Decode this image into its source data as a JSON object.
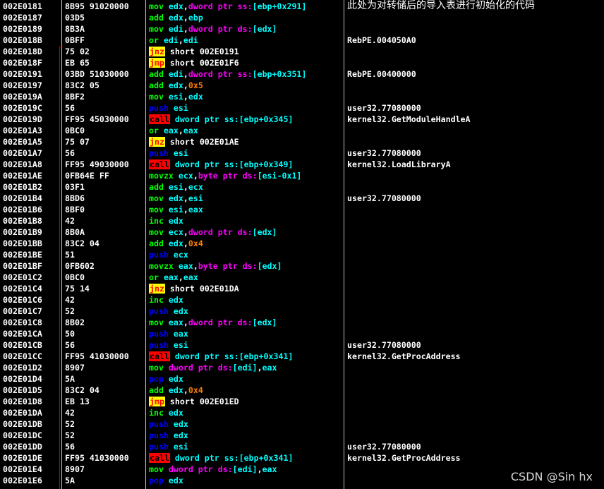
{
  "title": "此处为对转储后的导入表进行初始化的代码",
  "watermark": "CSDN @Sin hx",
  "rows": [
    {
      "addr": "002E0181",
      "hex": "8B95 91020000",
      "asm": [
        [
          "green",
          "mov "
        ],
        [
          "cyan",
          "edx"
        ],
        [
          "white",
          ","
        ],
        [
          "magenta",
          "dword ptr ss:"
        ],
        [
          "cyan",
          "[ebp+0x291]"
        ]
      ],
      "comment": ""
    },
    {
      "addr": "002E0187",
      "hex": "03D5",
      "asm": [
        [
          "green",
          "add "
        ],
        [
          "cyan",
          "edx"
        ],
        [
          "white",
          ","
        ],
        [
          "cyan",
          "ebp"
        ]
      ],
      "comment": ""
    },
    {
      "addr": "002E0189",
      "hex": "8B3A",
      "asm": [
        [
          "green",
          "mov "
        ],
        [
          "cyan",
          "edi"
        ],
        [
          "white",
          ","
        ],
        [
          "magenta",
          "dword ptr ds:"
        ],
        [
          "cyan",
          "[edx]"
        ]
      ],
      "comment": ""
    },
    {
      "addr": "002E018B",
      "hex": "0BFF",
      "asm": [
        [
          "green",
          "or "
        ],
        [
          "cyan",
          "edi"
        ],
        [
          "white",
          ","
        ],
        [
          "cyan",
          "edi"
        ]
      ],
      "comment": "RebPE.004050A0"
    },
    {
      "addr": "002E018D",
      "hex": "75 02",
      "asm": [
        [
          "jump",
          "jnz"
        ],
        [
          "white",
          " short 002E0191"
        ]
      ],
      "comment": ""
    },
    {
      "addr": "002E018F",
      "hex": "EB 65",
      "asm": [
        [
          "jump",
          "jmp"
        ],
        [
          "white",
          " short 002E01F6"
        ]
      ],
      "comment": ""
    },
    {
      "addr": "002E0191",
      "hex": "03BD 51030000",
      "asm": [
        [
          "green",
          "add "
        ],
        [
          "cyan",
          "edi"
        ],
        [
          "white",
          ","
        ],
        [
          "magenta",
          "dword ptr ss:"
        ],
        [
          "cyan",
          "[ebp+0x351]"
        ]
      ],
      "comment": "RebPE.00400000"
    },
    {
      "addr": "002E0197",
      "hex": "83C2 05",
      "asm": [
        [
          "green",
          "add "
        ],
        [
          "cyan",
          "edx"
        ],
        [
          "white",
          ","
        ],
        [
          "orange",
          "0x5"
        ]
      ],
      "comment": ""
    },
    {
      "addr": "002E019A",
      "hex": "8BF2",
      "asm": [
        [
          "green",
          "mov "
        ],
        [
          "cyan",
          "esi"
        ],
        [
          "white",
          ","
        ],
        [
          "cyan",
          "edx"
        ]
      ],
      "comment": ""
    },
    {
      "addr": "002E019C",
      "hex": "56",
      "asm": [
        [
          "blue",
          "push "
        ],
        [
          "cyan",
          "esi"
        ]
      ],
      "comment": "user32.77080000"
    },
    {
      "addr": "002E019D",
      "hex": "FF95 45030000",
      "asm": [
        [
          "call",
          "call"
        ],
        [
          "cyan",
          " dword ptr ss:"
        ],
        [
          "cyan",
          "[ebp+0x345]"
        ]
      ],
      "comment": "kernel32.GetModuleHandleA"
    },
    {
      "addr": "002E01A3",
      "hex": "0BC0",
      "asm": [
        [
          "green",
          "or "
        ],
        [
          "cyan",
          "eax"
        ],
        [
          "white",
          ","
        ],
        [
          "cyan",
          "eax"
        ]
      ],
      "comment": ""
    },
    {
      "addr": "002E01A5",
      "hex": "75 07",
      "asm": [
        [
          "jump",
          "jnz"
        ],
        [
          "white",
          " short 002E01AE"
        ]
      ],
      "comment": ""
    },
    {
      "addr": "002E01A7",
      "hex": "56",
      "asm": [
        [
          "blue",
          "push "
        ],
        [
          "cyan",
          "esi"
        ]
      ],
      "comment": "user32.77080000"
    },
    {
      "addr": "002E01A8",
      "hex": "FF95 49030000",
      "asm": [
        [
          "call",
          "call"
        ],
        [
          "cyan",
          " dword ptr ss:"
        ],
        [
          "cyan",
          "[ebp+0x349]"
        ]
      ],
      "comment": "kernel32.LoadLibraryA"
    },
    {
      "addr": "002E01AE",
      "hex": "0FB64E FF",
      "asm": [
        [
          "green",
          "movzx "
        ],
        [
          "cyan",
          "ecx"
        ],
        [
          "white",
          ","
        ],
        [
          "magenta",
          "byte ptr ds:"
        ],
        [
          "cyan",
          "[esi-0x1]"
        ]
      ],
      "comment": ""
    },
    {
      "addr": "002E01B2",
      "hex": "03F1",
      "asm": [
        [
          "green",
          "add "
        ],
        [
          "cyan",
          "esi"
        ],
        [
          "white",
          ","
        ],
        [
          "cyan",
          "ecx"
        ]
      ],
      "comment": ""
    },
    {
      "addr": "002E01B4",
      "hex": "8BD6",
      "asm": [
        [
          "green",
          "mov "
        ],
        [
          "cyan",
          "edx"
        ],
        [
          "white",
          ","
        ],
        [
          "cyan",
          "esi"
        ]
      ],
      "comment": "user32.77080000"
    },
    {
      "addr": "002E01B6",
      "hex": "8BF0",
      "asm": [
        [
          "green",
          "mov "
        ],
        [
          "cyan",
          "esi"
        ],
        [
          "white",
          ","
        ],
        [
          "cyan",
          "eax"
        ]
      ],
      "comment": ""
    },
    {
      "addr": "002E01B8",
      "hex": "42",
      "asm": [
        [
          "green",
          "inc "
        ],
        [
          "cyan",
          "edx"
        ]
      ],
      "comment": ""
    },
    {
      "addr": "002E01B9",
      "hex": "8B0A",
      "asm": [
        [
          "green",
          "mov "
        ],
        [
          "cyan",
          "ecx"
        ],
        [
          "white",
          ","
        ],
        [
          "magenta",
          "dword ptr ds:"
        ],
        [
          "cyan",
          "[edx]"
        ]
      ],
      "comment": ""
    },
    {
      "addr": "002E01BB",
      "hex": "83C2 04",
      "asm": [
        [
          "green",
          "add "
        ],
        [
          "cyan",
          "edx"
        ],
        [
          "white",
          ","
        ],
        [
          "orange",
          "0x4"
        ]
      ],
      "comment": ""
    },
    {
      "addr": "002E01BE",
      "hex": "51",
      "asm": [
        [
          "blue",
          "push "
        ],
        [
          "cyan",
          "ecx"
        ]
      ],
      "comment": ""
    },
    {
      "addr": "002E01BF",
      "hex": "0FB602",
      "asm": [
        [
          "green",
          "movzx "
        ],
        [
          "cyan",
          "eax"
        ],
        [
          "white",
          ","
        ],
        [
          "magenta",
          "byte ptr ds:"
        ],
        [
          "cyan",
          "[edx]"
        ]
      ],
      "comment": ""
    },
    {
      "addr": "002E01C2",
      "hex": "0BC0",
      "asm": [
        [
          "green",
          "or "
        ],
        [
          "cyan",
          "eax"
        ],
        [
          "white",
          ","
        ],
        [
          "cyan",
          "eax"
        ]
      ],
      "comment": ""
    },
    {
      "addr": "002E01C4",
      "hex": "75 14",
      "asm": [
        [
          "jump",
          "jnz"
        ],
        [
          "white",
          " short 002E01DA"
        ]
      ],
      "comment": ""
    },
    {
      "addr": "002E01C6",
      "hex": "42",
      "asm": [
        [
          "green",
          "inc "
        ],
        [
          "cyan",
          "edx"
        ]
      ],
      "comment": ""
    },
    {
      "addr": "002E01C7",
      "hex": "52",
      "asm": [
        [
          "blue",
          "push "
        ],
        [
          "cyan",
          "edx"
        ]
      ],
      "comment": ""
    },
    {
      "addr": "002E01C8",
      "hex": "8B02",
      "asm": [
        [
          "green",
          "mov "
        ],
        [
          "cyan",
          "eax"
        ],
        [
          "white",
          ","
        ],
        [
          "magenta",
          "dword ptr ds:"
        ],
        [
          "cyan",
          "[edx]"
        ]
      ],
      "comment": ""
    },
    {
      "addr": "002E01CA",
      "hex": "50",
      "asm": [
        [
          "blue",
          "push "
        ],
        [
          "cyan",
          "eax"
        ]
      ],
      "comment": ""
    },
    {
      "addr": "002E01CB",
      "hex": "56",
      "asm": [
        [
          "blue",
          "push "
        ],
        [
          "cyan",
          "esi"
        ]
      ],
      "comment": "user32.77080000"
    },
    {
      "addr": "002E01CC",
      "hex": "FF95 41030000",
      "asm": [
        [
          "call",
          "call"
        ],
        [
          "cyan",
          " dword ptr ss:"
        ],
        [
          "cyan",
          "[ebp+0x341]"
        ]
      ],
      "comment": "kernel32.GetProcAddress"
    },
    {
      "addr": "002E01D2",
      "hex": "8907",
      "asm": [
        [
          "green",
          "mov "
        ],
        [
          "magenta",
          "dword ptr ds:"
        ],
        [
          "cyan",
          "[edi]"
        ],
        [
          "white",
          ","
        ],
        [
          "cyan",
          "eax"
        ]
      ],
      "comment": ""
    },
    {
      "addr": "002E01D4",
      "hex": "5A",
      "asm": [
        [
          "blue",
          "pop "
        ],
        [
          "cyan",
          "edx"
        ]
      ],
      "comment": ""
    },
    {
      "addr": "002E01D5",
      "hex": "83C2 04",
      "asm": [
        [
          "green",
          "add "
        ],
        [
          "cyan",
          "edx"
        ],
        [
          "white",
          ","
        ],
        [
          "orange",
          "0x4"
        ]
      ],
      "comment": ""
    },
    {
      "addr": "002E01D8",
      "hex": "EB 13",
      "asm": [
        [
          "jump",
          "jmp"
        ],
        [
          "white",
          " short 002E01ED"
        ]
      ],
      "comment": ""
    },
    {
      "addr": "002E01DA",
      "hex": "42",
      "asm": [
        [
          "green",
          "inc "
        ],
        [
          "cyan",
          "edx"
        ]
      ],
      "comment": ""
    },
    {
      "addr": "002E01DB",
      "hex": "52",
      "asm": [
        [
          "blue",
          "push "
        ],
        [
          "cyan",
          "edx"
        ]
      ],
      "comment": ""
    },
    {
      "addr": "002E01DC",
      "hex": "52",
      "asm": [
        [
          "blue",
          "push "
        ],
        [
          "cyan",
          "edx"
        ]
      ],
      "comment": ""
    },
    {
      "addr": "002E01DD",
      "hex": "56",
      "asm": [
        [
          "blue",
          "push "
        ],
        [
          "cyan",
          "esi"
        ]
      ],
      "comment": "user32.77080000"
    },
    {
      "addr": "002E01DE",
      "hex": "FF95 41030000",
      "asm": [
        [
          "call",
          "call"
        ],
        [
          "cyan",
          " dword ptr ss:"
        ],
        [
          "cyan",
          "[ebp+0x341]"
        ]
      ],
      "comment": "kernel32.GetProcAddress"
    },
    {
      "addr": "002E01E4",
      "hex": "8907",
      "asm": [
        [
          "green",
          "mov "
        ],
        [
          "magenta",
          "dword ptr ds:"
        ],
        [
          "cyan",
          "[edi]"
        ],
        [
          "white",
          ","
        ],
        [
          "cyan",
          "eax"
        ]
      ],
      "comment": ""
    },
    {
      "addr": "002E01E6",
      "hex": "5A",
      "asm": [
        [
          "blue",
          "pop "
        ],
        [
          "cyan",
          "edx"
        ]
      ],
      "comment": ""
    }
  ]
}
